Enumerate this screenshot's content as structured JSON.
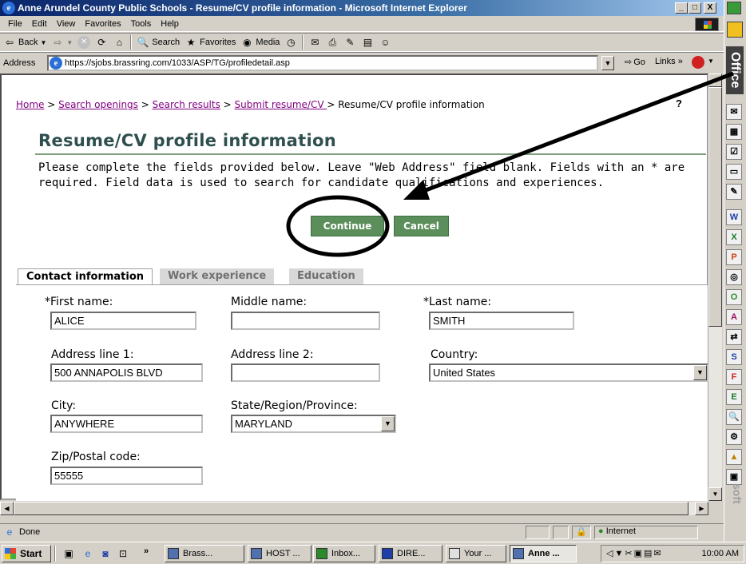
{
  "window": {
    "title": "Anne Arundel County Public Schools - Resume/CV profile information - Microsoft Internet Explorer",
    "min": "_",
    "max": "□",
    "close": "X"
  },
  "menu": [
    "File",
    "Edit",
    "View",
    "Favorites",
    "Tools",
    "Help"
  ],
  "toolbar": {
    "back": "Back",
    "search": "Search",
    "favorites": "Favorites",
    "media": "Media"
  },
  "address": {
    "label": "Address",
    "url": "https://sjobs.brassring.com/1033/ASP/TG/profiledetail.asp",
    "go": "Go",
    "links": "Links »"
  },
  "office": {
    "label": "Office",
    "soft": "soft"
  },
  "breadcrumb": {
    "home": "Home",
    "search_openings": "Search openings",
    "search_results": "Search results",
    "submit": "Submit resume/CV ",
    "current": "Resume/CV profile information",
    "sep": " > ",
    "help": "?"
  },
  "page": {
    "title": "Resume/CV profile information",
    "instructions": "Please complete the fields provided below. Leave \"Web Address\" field blank. Fields with an * are required. Field data is used to search for candidate qualifications and experiences.",
    "continue": "Continue",
    "cancel": "Cancel"
  },
  "tabs": {
    "contact": "Contact information",
    "work": "Work experience",
    "education": "Education"
  },
  "form": {
    "first_name_label": "*First name:",
    "first_name": "ALICE",
    "middle_name_label": "Middle name:",
    "middle_name": "",
    "last_name_label": "*Last name:",
    "last_name": "SMITH",
    "address1_label": "Address line 1:",
    "address1": "500 ANNAPOLIS BLVD",
    "address2_label": "Address line 2:",
    "address2": "",
    "country_label": "Country:",
    "country": "United States",
    "city_label": "City:",
    "city": "ANYWHERE",
    "state_label": "State/Region/Province:",
    "state": "MARYLAND",
    "zip_label": "Zip/Postal code:",
    "zip": "55555"
  },
  "status": {
    "text": "Done",
    "zone": "Internet"
  },
  "taskbar": {
    "start": "Start",
    "more": "»",
    "tasks": [
      "Brass...",
      "HOST ...",
      "Inbox...",
      "DIRE...",
      "Your ...",
      "Anne ..."
    ],
    "clock": "10:00 AM"
  }
}
